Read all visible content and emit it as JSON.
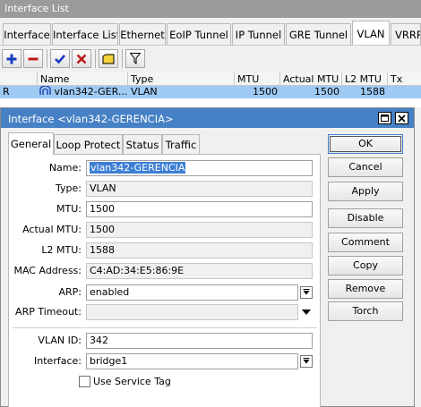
{
  "window": {
    "title": "Interface List"
  },
  "tabs": [
    {
      "label": "Interface"
    },
    {
      "label": "Interface List"
    },
    {
      "label": "Ethernet"
    },
    {
      "label": "EoIP Tunnel"
    },
    {
      "label": "IP Tunnel"
    },
    {
      "label": "GRE Tunnel"
    },
    {
      "label": "VLAN",
      "active": true
    },
    {
      "label": "VRRP"
    }
  ],
  "toolbar": {
    "buttons": [
      {
        "name": "add-button",
        "icon": "plus-icon",
        "color": "#1a3dbf"
      },
      {
        "name": "remove-button",
        "icon": "minus-icon",
        "color": "#c21a1a"
      },
      {
        "name": "enable-button",
        "icon": "check-icon",
        "color": "#1a3dbf"
      },
      {
        "name": "disable-button",
        "icon": "x-icon",
        "color": "#c21a1a"
      },
      {
        "name": "comment-button",
        "icon": "note-icon",
        "color": "#f4d23a"
      },
      {
        "name": "filter-button",
        "icon": "filter-icon",
        "color": "#000000"
      }
    ]
  },
  "grid": {
    "columns": [
      "",
      "Name",
      "Type",
      "MTU",
      "Actual MTU",
      "L2 MTU",
      "Tx"
    ],
    "rows": [
      {
        "flag": "R",
        "name": "vlan342-GER...",
        "type": "VLAN",
        "mtu": "1500",
        "actual_mtu": "1500",
        "l2_mtu": "1588",
        "tx": ""
      }
    ]
  },
  "dialog": {
    "title": "Interface <vlan342-GERENCIA>",
    "tabs": [
      "General",
      "Loop Protect",
      "Status",
      "Traffic"
    ],
    "active_tab": "General",
    "fields": {
      "name": {
        "label": "Name:",
        "value": "vlan342-GERENCIA"
      },
      "type": {
        "label": "Type:",
        "value": "VLAN"
      },
      "mtu": {
        "label": "MTU:",
        "value": "1500"
      },
      "actual_mtu": {
        "label": "Actual MTU:",
        "value": "1500"
      },
      "l2_mtu": {
        "label": "L2 MTU:",
        "value": "1588"
      },
      "mac": {
        "label": "MAC Address:",
        "value": "C4:AD:34:E5:86:9E"
      },
      "arp": {
        "label": "ARP:",
        "value": "enabled"
      },
      "arp_timeout": {
        "label": "ARP Timeout:",
        "value": ""
      },
      "vlan_id": {
        "label": "VLAN ID:",
        "value": "342"
      },
      "interface": {
        "label": "Interface:",
        "value": "bridge1"
      },
      "service_tag": {
        "label": "Use Service Tag",
        "checked": false
      }
    },
    "buttons": {
      "ok": "OK",
      "cancel": "Cancel",
      "apply": "Apply",
      "disable": "Disable",
      "comment": "Comment",
      "copy": "Copy",
      "remove": "Remove",
      "torch": "Torch"
    }
  },
  "colors": {
    "title_bar_inactive": "#9b9b9b",
    "title_bar_active": "#4781c5",
    "row_selected": "#9ecaf4",
    "text_selection": "#3c7fd4"
  }
}
